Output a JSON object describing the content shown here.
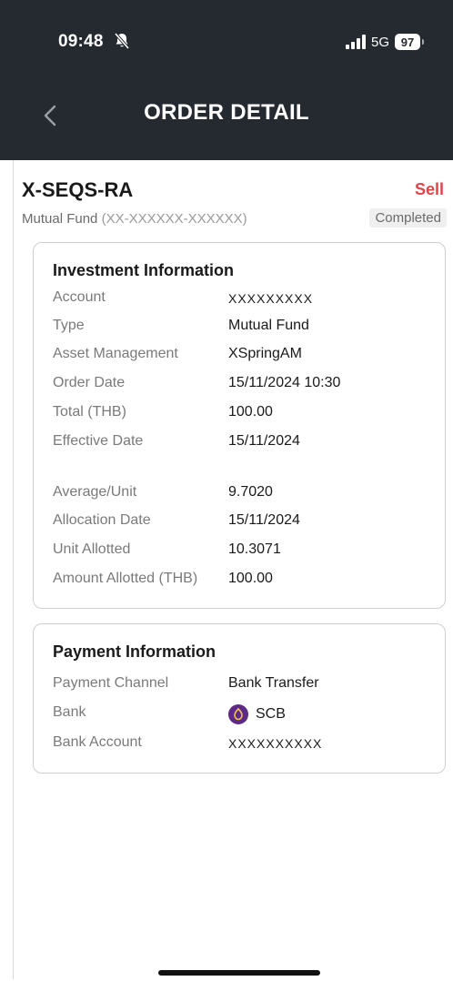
{
  "status_bar": {
    "time": "09:48",
    "network": "5G",
    "battery": "97"
  },
  "header": {
    "title": "ORDER DETAIL"
  },
  "fund": {
    "code": "X-SEQS-RA",
    "side": "Sell",
    "type": "Mutual Fund",
    "account_mask": "XX-XXXXXX-XXXXXX",
    "status": "Completed"
  },
  "investment": {
    "title": "Investment Information",
    "rows": [
      {
        "label": "Account",
        "value": "XXXXXXXXX"
      },
      {
        "label": "Type",
        "value": "Mutual Fund"
      },
      {
        "label": "Asset Management",
        "value": "XSpringAM"
      },
      {
        "label": "Order Date",
        "value": "15/11/2024 10:30"
      },
      {
        "label": "Total (THB)",
        "value": "100.00"
      },
      {
        "label": "Effective Date",
        "value": "15/11/2024"
      },
      {
        "label": "Average/Unit",
        "value": "9.7020"
      },
      {
        "label": "Allocation Date",
        "value": "15/11/2024"
      },
      {
        "label": "Unit Allotted",
        "value": "10.3071"
      },
      {
        "label": "Amount Allotted (THB)",
        "value": "100.00"
      }
    ]
  },
  "payment": {
    "title": "Payment Information",
    "rows": [
      {
        "label": "Payment Channel",
        "value": "Bank Transfer"
      },
      {
        "label": "Bank",
        "value": "SCB"
      },
      {
        "label": "Bank Account",
        "value": "XXXXXXXXXX"
      }
    ]
  },
  "colors": {
    "header_bg": "#252a31",
    "sell": "#e0454b",
    "scb_purple": "#5e2a8a"
  }
}
